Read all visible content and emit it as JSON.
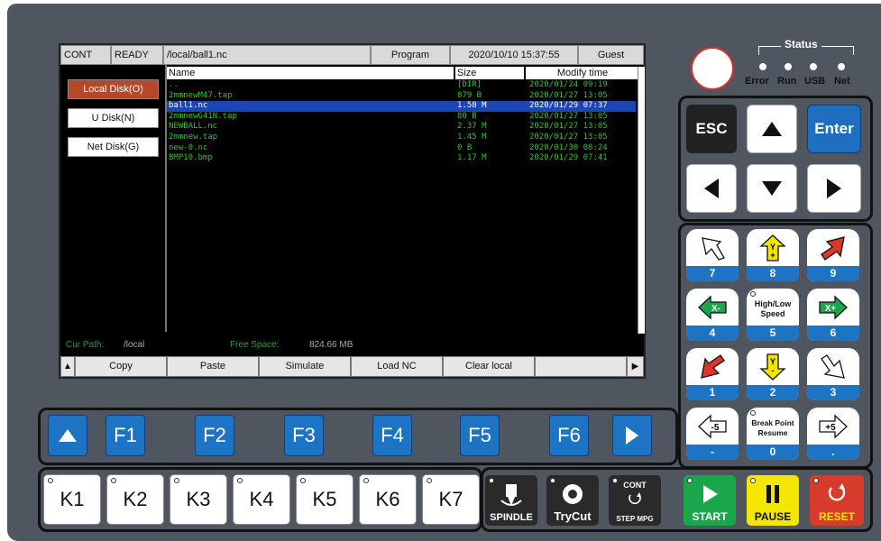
{
  "colors": {
    "panel": "#4f5660",
    "screen_bg": "#000000",
    "selected_row": "#1c45b8",
    "file_text": "#33c233",
    "key_blue": "#1d73c4",
    "start_green": "#1aa64a",
    "pause_yellow": "#f3e600",
    "reset_red": "#d63b2c"
  },
  "status_bar": {
    "mode": "CONT",
    "state": "READY",
    "path": "/local/ball1.nc",
    "tab": "Program",
    "datetime": "2020/10/10 15:37:55",
    "user": "Guest"
  },
  "disks": [
    {
      "label": "Local Disk(O)",
      "active": true
    },
    {
      "label": "U Disk(N)",
      "active": false
    },
    {
      "label": "Net Disk(G)",
      "active": false
    }
  ],
  "file_table": {
    "headers": {
      "name": "Name",
      "size": "Size",
      "time": "Modify time"
    },
    "rows": [
      {
        "name": "..",
        "size": "[DIR]",
        "time": "2020/01/24 09:19",
        "selected": false
      },
      {
        "name": "2mmnewM47.tap",
        "size": "879 B",
        "time": "2020/01/27 13:05",
        "selected": false
      },
      {
        "name": "ball1.nc",
        "size": "1.58 M",
        "time": "2020/01/29 07:37",
        "selected": true
      },
      {
        "name": "2mmnewG41N.tap",
        "size": "80 B",
        "time": "2020/01/27 13:05",
        "selected": false
      },
      {
        "name": "NEWBALL.nc",
        "size": "2.37 M",
        "time": "2020/01/27 13:05",
        "selected": false
      },
      {
        "name": "2mmnew.tap",
        "size": "1.45 M",
        "time": "2020/01/27 13:05",
        "selected": false
      },
      {
        "name": "new-0.nc",
        "size": "0 B",
        "time": "2020/01/30 08:24",
        "selected": false
      },
      {
        "name": "BMP10.bmp",
        "size": "1.17 M",
        "time": "2020/01/29 07:41",
        "selected": false
      }
    ]
  },
  "footer": {
    "cur_path_label": "Cur Path:",
    "cur_path": "/local",
    "free_space_label": "Free Space:",
    "free_space": "824.66 MB"
  },
  "softkeys": [
    "Copy",
    "Paste",
    "Simulate",
    "Load NC",
    "Clear local",
    ""
  ],
  "status_leds": {
    "title": "Status",
    "items": [
      "Error",
      "Run",
      "USB",
      "Net"
    ]
  },
  "nav_keys": {
    "esc": "ESC",
    "enter": "Enter"
  },
  "num_keys": [
    {
      "num": "7",
      "icon": "xy-diagonal-down-icon"
    },
    {
      "num": "8",
      "icon": "y-plus-icon",
      "axis": "Y+"
    },
    {
      "num": "9",
      "icon": "xy-diagonal-up-icon"
    },
    {
      "num": "4",
      "icon": "x-minus-icon",
      "axis": "X-"
    },
    {
      "num": "5",
      "icon": "",
      "text": "High/Low Speed"
    },
    {
      "num": "6",
      "icon": "x-plus-icon",
      "axis": "X+"
    },
    {
      "num": "1",
      "icon": "xy-diagonal-red-icon"
    },
    {
      "num": "2",
      "icon": "y-minus-icon",
      "axis": "Y-"
    },
    {
      "num": "3",
      "icon": "xy-diagonal-up-right-icon"
    },
    {
      "num": "-",
      "icon": "minus-5-icon",
      "axis": "-5"
    },
    {
      "num": "0",
      "icon": "",
      "text": "Break Point Resume"
    },
    {
      "num": ".",
      "icon": "plus-5-icon",
      "axis": "+5"
    }
  ],
  "fkeys": [
    "F1",
    "F2",
    "F3",
    "F4",
    "F5",
    "F6"
  ],
  "kkeys": [
    "K1",
    "K2",
    "K3",
    "K4",
    "K5",
    "K6",
    "K7"
  ],
  "func_keys": {
    "spindle": "SPINDLE",
    "trycut": "TryCut",
    "cont": "CONT",
    "stepmpg": "STEP MPG",
    "start": "START",
    "pause": "PAUSE",
    "reset": "RESET"
  }
}
